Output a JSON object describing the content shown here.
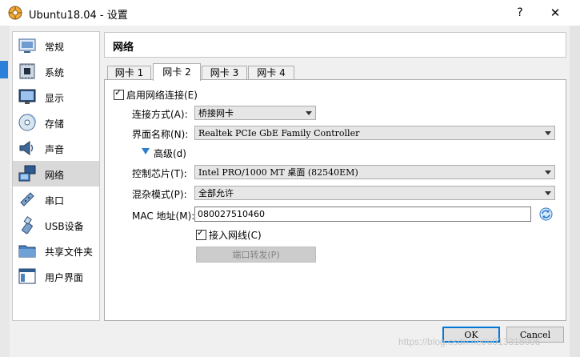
{
  "window": {
    "title": "Ubuntu18.04 - 设置",
    "help_label": "?",
    "close_label": "✕"
  },
  "sidebar": {
    "items": [
      {
        "label": "常规",
        "icon": "general-icon"
      },
      {
        "label": "系统",
        "icon": "system-chip-icon"
      },
      {
        "label": "显示",
        "icon": "display-monitor-icon"
      },
      {
        "label": "存储",
        "icon": "storage-disk-icon"
      },
      {
        "label": "声音",
        "icon": "speaker-icon"
      },
      {
        "label": "网络",
        "icon": "network-icon",
        "selected": true
      },
      {
        "label": "串口",
        "icon": "serial-port-icon"
      },
      {
        "label": "USB设备",
        "icon": "usb-icon"
      },
      {
        "label": "共享文件夹",
        "icon": "shared-folder-icon"
      },
      {
        "label": "用户界面",
        "icon": "user-interface-icon"
      }
    ]
  },
  "header": {
    "title": "网络"
  },
  "tabs": [
    {
      "label": "网卡 1"
    },
    {
      "label": "网卡 2",
      "active": true
    },
    {
      "label": "网卡 3"
    },
    {
      "label": "网卡 4"
    }
  ],
  "network": {
    "enable_label": "启用网络连接(E)",
    "enable_checked": true,
    "attached_label": "连接方式(A):",
    "attached_value": "桥接网卡",
    "name_label": "界面名称(N):",
    "name_value": "Realtek PCIe GbE Family Controller",
    "advanced_label": "高级(d)",
    "adapter_label": "控制芯片(T):",
    "adapter_value": "Intel PRO/1000 MT 桌面 (82540EM)",
    "promisc_label": "混杂模式(P):",
    "promisc_value": "全部允许",
    "mac_label": "MAC 地址(M):",
    "mac_value": "080027510460",
    "cable_label": "接入网线(C)",
    "cable_checked": true,
    "port_forward_label": "端口转发(P)"
  },
  "footer": {
    "ok_label": "OK",
    "cancel_label": "Cancel"
  },
  "watermark": "https://blog.csdn.net/u013318006"
}
